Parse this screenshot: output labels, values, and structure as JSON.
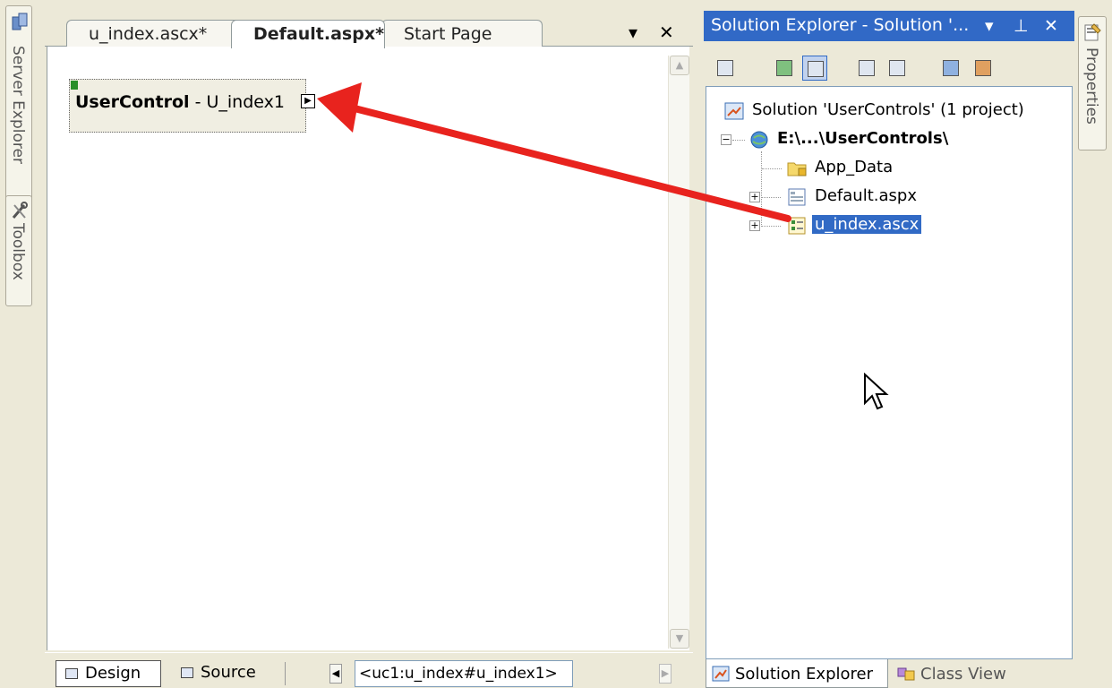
{
  "left_dock": {
    "server_explorer_label": "Server Explorer",
    "toolbox_label": "Toolbox",
    "server_icon": "server-explorer-icon",
    "toolbox_icon": "toolbox-icon"
  },
  "document": {
    "tabs": [
      {
        "label": "u_index.ascx*",
        "active": false
      },
      {
        "label": "Default.aspx*",
        "active": true
      },
      {
        "label": "Start Page",
        "active": false
      }
    ],
    "dropdown_glyph": "▾",
    "close_glyph": "✕",
    "user_control": {
      "type_label": "UserControl",
      "separator": " - ",
      "id_label": "U_index1"
    },
    "bottom_bar": {
      "design_label": "Design",
      "source_label": "Source",
      "tag_crumb": "<uc1:u_index#u_index1>"
    }
  },
  "solution_explorer": {
    "title": "Solution Explorer - Solution '...",
    "pin_glyph": "ᵖ",
    "tree": {
      "solution": "Solution 'UserControls' (1 project)",
      "project": "E:\\...\\UserControls\\",
      "items": [
        "App_Data",
        "Default.aspx",
        "u_index.ascx"
      ],
      "selected": "u_index.ascx"
    },
    "bottom_tabs": [
      "Solution Explorer",
      "Class View"
    ]
  },
  "right_dock": {
    "properties_label": "Properties",
    "properties_icon": "properties-icon"
  },
  "annotation": {
    "arrow_color": "#e8231e"
  },
  "colors": {
    "header_blue": "#3169c6",
    "selection_blue": "#316ac5"
  }
}
